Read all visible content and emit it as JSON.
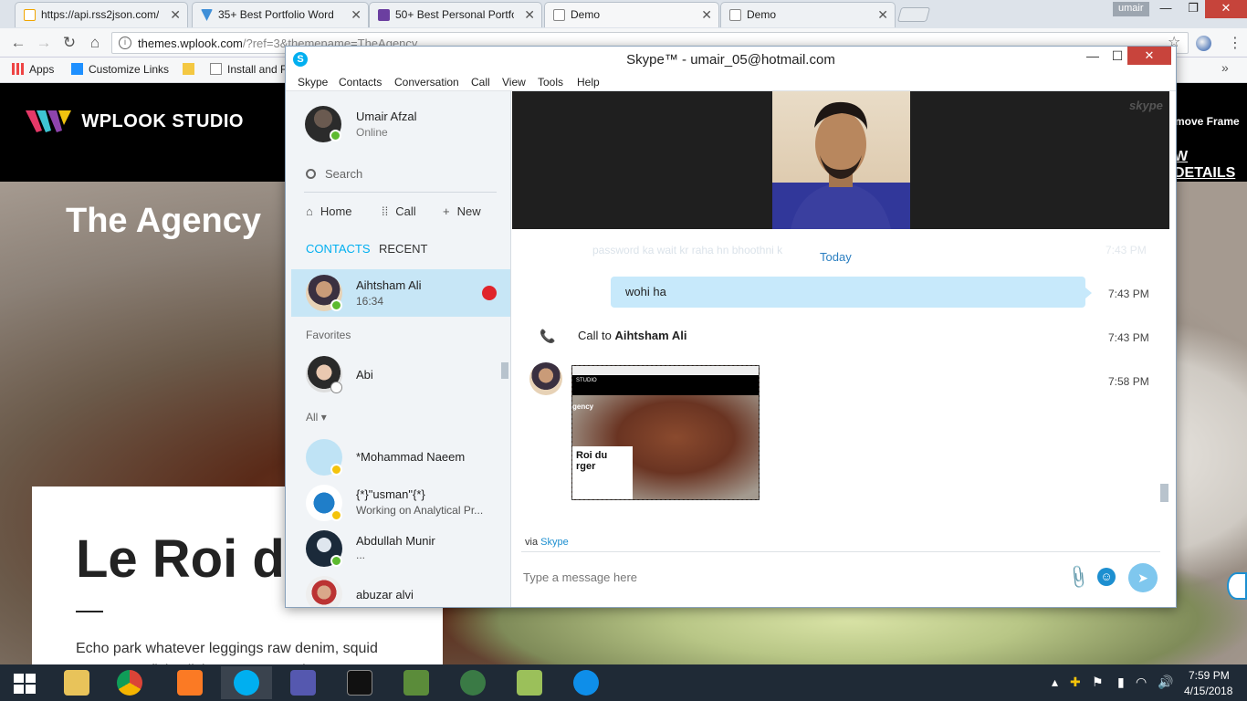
{
  "browser": {
    "tabs": [
      {
        "label": "https://api.rss2json.com/",
        "favicon_color": "#f0a400"
      },
      {
        "label": "35+ Best Portfolio Word",
        "favicon_color": "#3f8fd8"
      },
      {
        "label": "50+ Best Personal Portfo",
        "favicon_color": "#6b3fa0"
      },
      {
        "label": "Demo",
        "favicon_color": "#ffffff"
      },
      {
        "label": "Demo",
        "favicon_color": "#ffffff"
      }
    ],
    "profile": "umair",
    "url_host": "themes.wplook.com",
    "url_rest": "/?ref=3&themename=TheAgency",
    "bookmarks": [
      {
        "label": "Apps",
        "icon": "apps-grid-icon"
      },
      {
        "label": "Customize Links",
        "icon": "windows-icon"
      },
      {
        "label": "",
        "icon": "folder-icon"
      },
      {
        "label": "Install and F",
        "icon": "page-icon"
      }
    ]
  },
  "website": {
    "brand": "WPLOOK STUDIO",
    "remove_frame": "move Frame",
    "view_details": "W DETAILS",
    "hero_title": "The Agency",
    "card_title": "Le Roi d Burger",
    "card_text": "Echo park whatever leggings raw denim, squid stumptown fixie cliche. Messenger bag DIY +1 fixie butcher scenester cred. American apparel"
  },
  "skype": {
    "title": "Skype™ - umair_05@hotmail.com",
    "menu": [
      "Skype",
      "Contacts",
      "Conversation",
      "Call",
      "View",
      "Tools",
      "Help"
    ],
    "me": {
      "name": "Umair Afzal",
      "status": "Online"
    },
    "search_placeholder": "Search",
    "nav": {
      "home": "Home",
      "call": "Call",
      "new": "New"
    },
    "tabs": {
      "contacts": "CONTACTS",
      "recent": "RECENT"
    },
    "selected_contact": {
      "name": "Aihtsham Ali",
      "sub": "16:34"
    },
    "favorites_label": "Favorites",
    "favorites": [
      {
        "name": "Abi"
      }
    ],
    "all_label": "All",
    "contacts": [
      {
        "name": "*Mohammad Naeem",
        "sub": ""
      },
      {
        "name": "{*}\"usman\"{*}",
        "sub": "Working on Analytical Pr..."
      },
      {
        "name": "Abdullah Munir",
        "sub": "..."
      },
      {
        "name": "abuzar alvi",
        "sub": ""
      }
    ],
    "watermark": "skype",
    "faded_message": "password ka wait kr raha hn bhoothni k",
    "faded_time": "7:43 PM",
    "date_divider": "Today",
    "messages": [
      {
        "text": "wohi ha",
        "time": "7:43 PM"
      },
      {
        "call_prefix": "Call to ",
        "call_name": "Aihtsham Ali",
        "time": "7:43 PM"
      },
      {
        "time": "7:58 PM"
      }
    ],
    "screenshot_thumb": {
      "label": "gency",
      "card": "Roi du rger",
      "bar": "STUDIO"
    },
    "via_prefix": "via ",
    "via_link": "Skype",
    "compose_placeholder": "Type a message here"
  },
  "taskbar": {
    "time": "7:59 PM",
    "date": "4/15/2018"
  }
}
